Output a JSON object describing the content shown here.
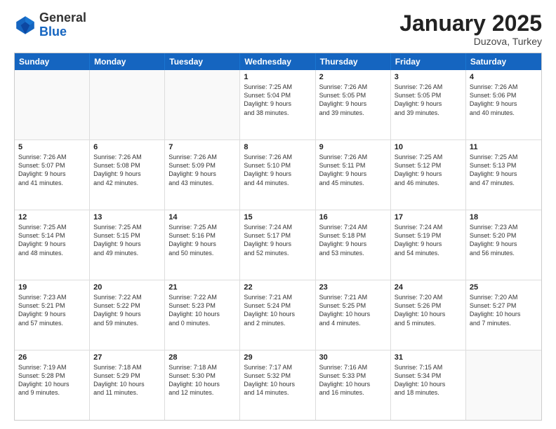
{
  "header": {
    "logo_general": "General",
    "logo_blue": "Blue",
    "month_title": "January 2025",
    "location": "Duzova, Turkey"
  },
  "weekdays": [
    "Sunday",
    "Monday",
    "Tuesday",
    "Wednesday",
    "Thursday",
    "Friday",
    "Saturday"
  ],
  "rows": [
    [
      {
        "day": "",
        "empty": true
      },
      {
        "day": "",
        "empty": true
      },
      {
        "day": "",
        "empty": true
      },
      {
        "day": "1",
        "lines": [
          "Sunrise: 7:25 AM",
          "Sunset: 5:04 PM",
          "Daylight: 9 hours",
          "and 38 minutes."
        ]
      },
      {
        "day": "2",
        "lines": [
          "Sunrise: 7:26 AM",
          "Sunset: 5:05 PM",
          "Daylight: 9 hours",
          "and 39 minutes."
        ]
      },
      {
        "day": "3",
        "lines": [
          "Sunrise: 7:26 AM",
          "Sunset: 5:05 PM",
          "Daylight: 9 hours",
          "and 39 minutes."
        ]
      },
      {
        "day": "4",
        "lines": [
          "Sunrise: 7:26 AM",
          "Sunset: 5:06 PM",
          "Daylight: 9 hours",
          "and 40 minutes."
        ]
      }
    ],
    [
      {
        "day": "5",
        "lines": [
          "Sunrise: 7:26 AM",
          "Sunset: 5:07 PM",
          "Daylight: 9 hours",
          "and 41 minutes."
        ]
      },
      {
        "day": "6",
        "lines": [
          "Sunrise: 7:26 AM",
          "Sunset: 5:08 PM",
          "Daylight: 9 hours",
          "and 42 minutes."
        ]
      },
      {
        "day": "7",
        "lines": [
          "Sunrise: 7:26 AM",
          "Sunset: 5:09 PM",
          "Daylight: 9 hours",
          "and 43 minutes."
        ]
      },
      {
        "day": "8",
        "lines": [
          "Sunrise: 7:26 AM",
          "Sunset: 5:10 PM",
          "Daylight: 9 hours",
          "and 44 minutes."
        ]
      },
      {
        "day": "9",
        "lines": [
          "Sunrise: 7:26 AM",
          "Sunset: 5:11 PM",
          "Daylight: 9 hours",
          "and 45 minutes."
        ]
      },
      {
        "day": "10",
        "lines": [
          "Sunrise: 7:25 AM",
          "Sunset: 5:12 PM",
          "Daylight: 9 hours",
          "and 46 minutes."
        ]
      },
      {
        "day": "11",
        "lines": [
          "Sunrise: 7:25 AM",
          "Sunset: 5:13 PM",
          "Daylight: 9 hours",
          "and 47 minutes."
        ]
      }
    ],
    [
      {
        "day": "12",
        "lines": [
          "Sunrise: 7:25 AM",
          "Sunset: 5:14 PM",
          "Daylight: 9 hours",
          "and 48 minutes."
        ]
      },
      {
        "day": "13",
        "lines": [
          "Sunrise: 7:25 AM",
          "Sunset: 5:15 PM",
          "Daylight: 9 hours",
          "and 49 minutes."
        ]
      },
      {
        "day": "14",
        "lines": [
          "Sunrise: 7:25 AM",
          "Sunset: 5:16 PM",
          "Daylight: 9 hours",
          "and 50 minutes."
        ]
      },
      {
        "day": "15",
        "lines": [
          "Sunrise: 7:24 AM",
          "Sunset: 5:17 PM",
          "Daylight: 9 hours",
          "and 52 minutes."
        ]
      },
      {
        "day": "16",
        "lines": [
          "Sunrise: 7:24 AM",
          "Sunset: 5:18 PM",
          "Daylight: 9 hours",
          "and 53 minutes."
        ]
      },
      {
        "day": "17",
        "lines": [
          "Sunrise: 7:24 AM",
          "Sunset: 5:19 PM",
          "Daylight: 9 hours",
          "and 54 minutes."
        ]
      },
      {
        "day": "18",
        "lines": [
          "Sunrise: 7:23 AM",
          "Sunset: 5:20 PM",
          "Daylight: 9 hours",
          "and 56 minutes."
        ]
      }
    ],
    [
      {
        "day": "19",
        "lines": [
          "Sunrise: 7:23 AM",
          "Sunset: 5:21 PM",
          "Daylight: 9 hours",
          "and 57 minutes."
        ]
      },
      {
        "day": "20",
        "lines": [
          "Sunrise: 7:22 AM",
          "Sunset: 5:22 PM",
          "Daylight: 9 hours",
          "and 59 minutes."
        ]
      },
      {
        "day": "21",
        "lines": [
          "Sunrise: 7:22 AM",
          "Sunset: 5:23 PM",
          "Daylight: 10 hours",
          "and 0 minutes."
        ]
      },
      {
        "day": "22",
        "lines": [
          "Sunrise: 7:21 AM",
          "Sunset: 5:24 PM",
          "Daylight: 10 hours",
          "and 2 minutes."
        ]
      },
      {
        "day": "23",
        "lines": [
          "Sunrise: 7:21 AM",
          "Sunset: 5:25 PM",
          "Daylight: 10 hours",
          "and 4 minutes."
        ]
      },
      {
        "day": "24",
        "lines": [
          "Sunrise: 7:20 AM",
          "Sunset: 5:26 PM",
          "Daylight: 10 hours",
          "and 5 minutes."
        ]
      },
      {
        "day": "25",
        "lines": [
          "Sunrise: 7:20 AM",
          "Sunset: 5:27 PM",
          "Daylight: 10 hours",
          "and 7 minutes."
        ]
      }
    ],
    [
      {
        "day": "26",
        "lines": [
          "Sunrise: 7:19 AM",
          "Sunset: 5:28 PM",
          "Daylight: 10 hours",
          "and 9 minutes."
        ]
      },
      {
        "day": "27",
        "lines": [
          "Sunrise: 7:18 AM",
          "Sunset: 5:29 PM",
          "Daylight: 10 hours",
          "and 11 minutes."
        ]
      },
      {
        "day": "28",
        "lines": [
          "Sunrise: 7:18 AM",
          "Sunset: 5:30 PM",
          "Daylight: 10 hours",
          "and 12 minutes."
        ]
      },
      {
        "day": "29",
        "lines": [
          "Sunrise: 7:17 AM",
          "Sunset: 5:32 PM",
          "Daylight: 10 hours",
          "and 14 minutes."
        ]
      },
      {
        "day": "30",
        "lines": [
          "Sunrise: 7:16 AM",
          "Sunset: 5:33 PM",
          "Daylight: 10 hours",
          "and 16 minutes."
        ]
      },
      {
        "day": "31",
        "lines": [
          "Sunrise: 7:15 AM",
          "Sunset: 5:34 PM",
          "Daylight: 10 hours",
          "and 18 minutes."
        ]
      },
      {
        "day": "",
        "empty": true
      }
    ]
  ]
}
